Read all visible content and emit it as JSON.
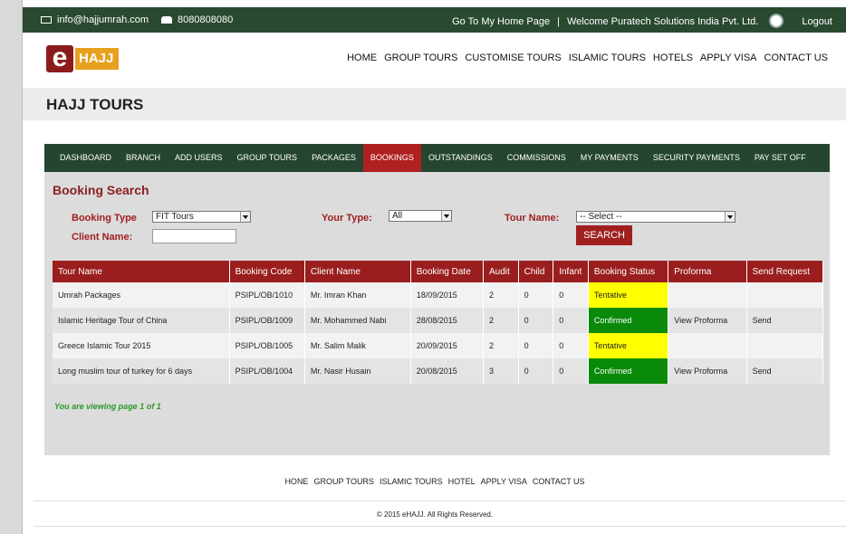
{
  "topbar": {
    "email": "info@hajjumrah.com",
    "phone": "8080808080",
    "home_link": "Go To My Home Page",
    "divider": "|",
    "welcome": "Welcome Puratech Solutions India Pvt. Ltd.",
    "logout": "Logout"
  },
  "logo": {
    "letter": "e",
    "word": "HAJJ"
  },
  "mainnav": [
    "HOME",
    "GROUP TOURS",
    "CUSTOMISE TOURS",
    "ISLAMIC TOURS",
    "HOTELS",
    "APPLY VISA",
    "CONTACT US"
  ],
  "page_title": "HAJJ TOURS",
  "subnav": [
    "DASHBOARD",
    "BRANCH",
    "ADD USERS",
    "GROUP TOURS",
    "PACKAGES",
    "BOOKINGS",
    "OUTSTANDINGS",
    "COMMISSIONS",
    "MY PAYMENTS",
    "SECURITY PAYMENTS",
    "PAY SET OFF"
  ],
  "search": {
    "title": "Booking Search",
    "booking_type_label": "Booking Type",
    "booking_type_value": "FIT Tours",
    "your_type_label": "Your Type:",
    "your_type_value": "All",
    "tour_name_label": "Tour Name:",
    "tour_name_value": "-- Select --",
    "client_name_label": "Client Name:",
    "client_name_value": "",
    "search_button": "SEARCH"
  },
  "table": {
    "headers": [
      "Tour Name",
      "Booking Code",
      "Client Name",
      "Booking Date",
      "Audit",
      "Child",
      "Infant",
      "Booking Status",
      "Proforma",
      "Send Request"
    ],
    "rows": [
      [
        "Umrah Packages",
        "PSIPL/OB/1010",
        "Mr. Imran Khan",
        "18/09/2015",
        "2",
        "0",
        "0",
        "Tentative",
        "",
        ""
      ],
      [
        "Islamic Heritage Tour of China",
        "PSIPL/OB/1009",
        "Mr. Mohammed Nabi",
        "28/08/2015",
        "2",
        "0",
        "0",
        "Confirmed",
        "View Proforma",
        "Send"
      ],
      [
        "Greece Islamic Tour 2015",
        "PSIPL/OB/1005",
        "Mr. Salim Malik",
        "20/09/2015",
        "2",
        "0",
        "0",
        "Tentative",
        "",
        ""
      ],
      [
        "Long muslim tour of turkey for 6 days",
        "PSIPL/OB/1004",
        "Mr. Nasir Husain",
        "20/08/2015",
        "3",
        "0",
        "0",
        "Confirmed",
        "View Proforma",
        "Send"
      ]
    ]
  },
  "viewing": "You are viewing page 1 of 1",
  "footer_nav": [
    "HONE",
    "GROUP TOURS",
    "ISLAMIC TOURS",
    "HOTEL",
    "APPLY VISA",
    "CONTACT US"
  ],
  "copyright": "© 2015 eHAJJ. All Rights Reserved.",
  "colors": {
    "dark_green": "#2a4a30",
    "brand_red": "#9a1e1e",
    "tentative": "#ffff00",
    "confirmed": "#0a8a0a"
  }
}
